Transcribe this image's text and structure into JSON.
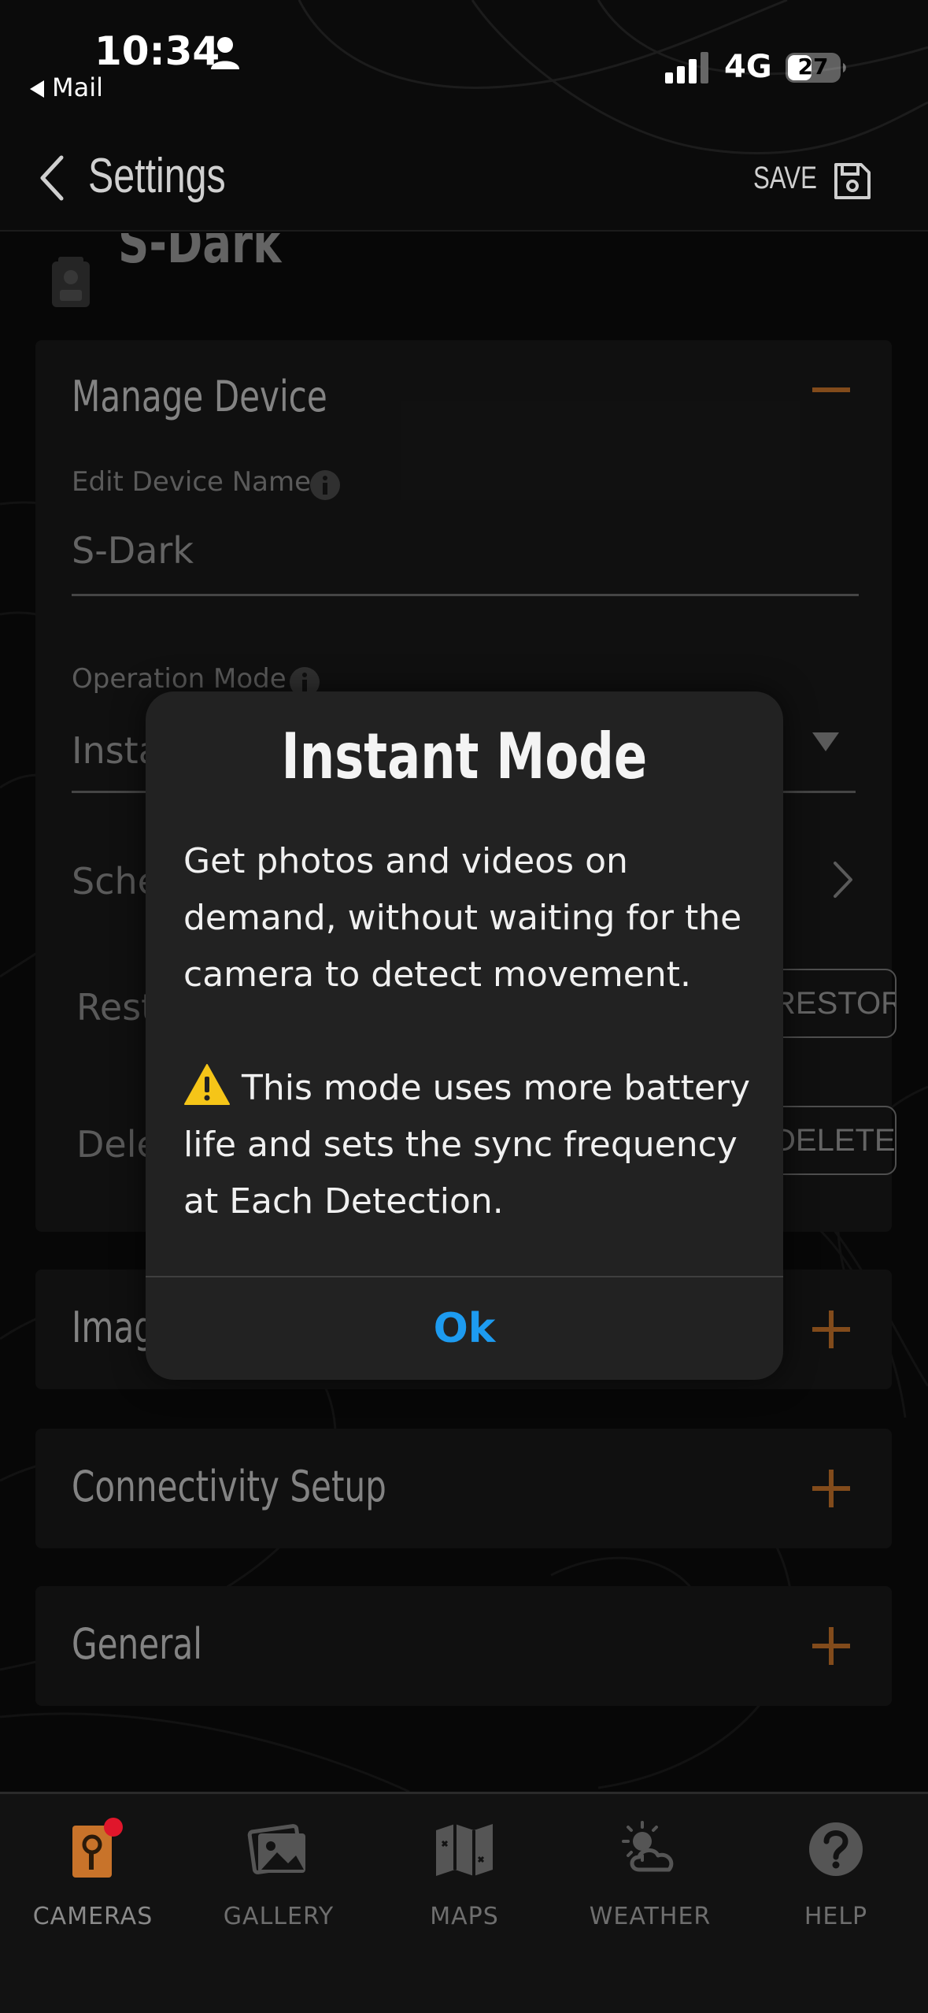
{
  "status_bar": {
    "time": "10:34",
    "back_app": "Mail",
    "network": "4G",
    "battery": "27"
  },
  "header": {
    "title": "Settings",
    "save_label": "SAVE"
  },
  "device": {
    "name_title": "S-Dark"
  },
  "manage_device": {
    "title": "Manage Device",
    "edit_name_label": "Edit Device Name",
    "edit_name_value": "S-Dark",
    "operation_mode_label": "Operation Mode",
    "operation_mode_value": "Instant",
    "schedule_label": "Schedule",
    "restore_label": "Restore",
    "restore_button": "RESTORE",
    "delete_label": "Delete",
    "delete_button": "DELETE"
  },
  "sections": [
    {
      "title": "Image"
    },
    {
      "title": "Connectivity Setup"
    },
    {
      "title": "General"
    }
  ],
  "modal": {
    "title": "Instant Mode",
    "body1": "Get photos and videos on demand, without waiting for the camera to detect movement.",
    "body2": "This mode uses more battery life and sets the sync frequency at Each Detection.",
    "ok": "Ok"
  },
  "nav": [
    {
      "label": "CAMERAS",
      "icon": "camera-icon",
      "active": true
    },
    {
      "label": "GALLERY",
      "icon": "gallery-icon"
    },
    {
      "label": "MAPS",
      "icon": "map-icon"
    },
    {
      "label": "WEATHER",
      "icon": "weather-icon"
    },
    {
      "label": "HELP",
      "icon": "help-icon"
    }
  ],
  "colors": {
    "accent": "#c8732a",
    "link": "#1d9bf0",
    "badge": "#e0162b"
  }
}
